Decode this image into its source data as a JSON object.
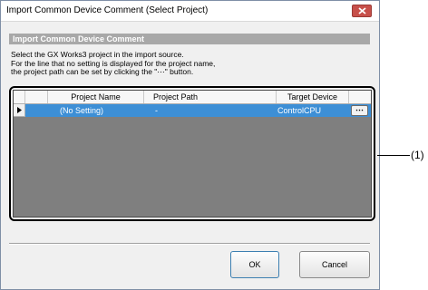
{
  "window": {
    "title": "Import Common Device Comment (Select Project)"
  },
  "header": {
    "title": "Import Common Device Comment"
  },
  "description": {
    "line1": "Select the GX Works3 project in the import source.",
    "line2": "For the line that no setting is displayed for the project name,",
    "line3": "the project path can be set by clicking the \"⋯\" button."
  },
  "grid": {
    "columns": [
      "Project Name",
      "Project Path",
      "Target Device"
    ],
    "rows": [
      {
        "project_name": "(No Setting)",
        "project_path": "-",
        "target_device": "ControlCPU",
        "button": "⋯"
      }
    ]
  },
  "callout": {
    "label": "(1)"
  },
  "buttons": {
    "ok": "OK",
    "cancel": "Cancel"
  },
  "colors": {
    "selection": "#3d8fd6",
    "header_band": "#a8a8a8",
    "grid_empty": "#7f7f7f",
    "close_button": "#c7504a"
  },
  "icons": {
    "close": "close-x-icon",
    "row_pointer": "row-pointer-icon"
  }
}
